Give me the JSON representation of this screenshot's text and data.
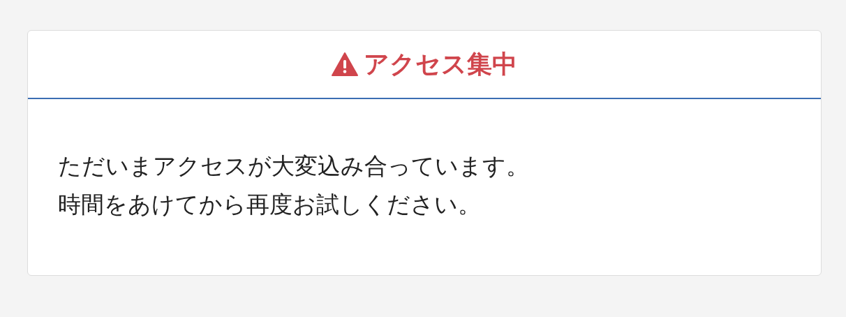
{
  "notice": {
    "title": "アクセス集中",
    "message_lines": [
      "ただいまアクセスが大変込み合っています。",
      "時間をあけてから再度お試しください。"
    ]
  }
}
